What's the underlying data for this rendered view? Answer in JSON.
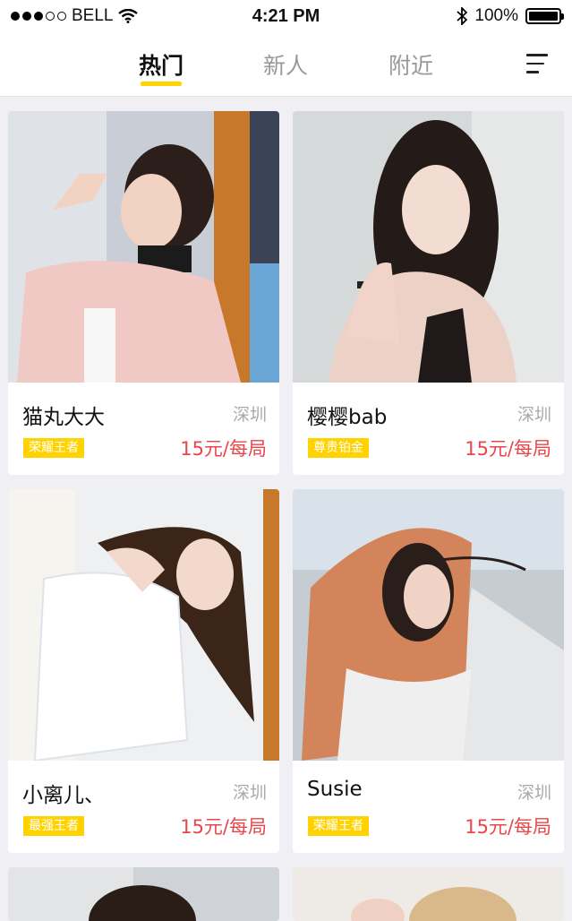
{
  "status_bar": {
    "carrier": "BELL",
    "time": "4:21 PM",
    "battery": "100%",
    "signal_icon": "signal-dots-icon",
    "wifi_icon": "wifi-icon",
    "bluetooth_icon": "bluetooth-icon",
    "battery_level": 1.0
  },
  "tabs": [
    {
      "label": "热门",
      "active": true
    },
    {
      "label": "新人",
      "active": false
    },
    {
      "label": "附近",
      "active": false
    }
  ],
  "menu_icon": "menu-icon",
  "accent_color": "#ffd200",
  "price_color": "#e8464a",
  "cards": [
    {
      "name": "猫丸大大",
      "city": "深圳",
      "badge": "荣耀王者",
      "price": "15元/每局"
    },
    {
      "name": "樱樱bab",
      "city": "深圳",
      "badge": "尊贵铂金",
      "price": "15元/每局"
    },
    {
      "name": "小离儿、",
      "city": "深圳",
      "badge": "最强王者",
      "price": "15元/每局"
    },
    {
      "name": "Susie",
      "city": "深圳",
      "badge": "荣耀王者",
      "price": "15元/每局"
    }
  ]
}
